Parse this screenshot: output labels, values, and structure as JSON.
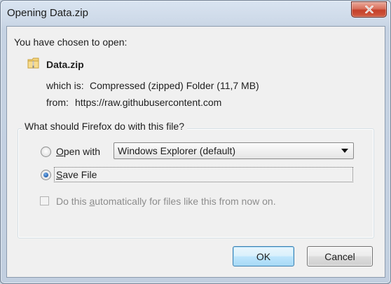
{
  "window": {
    "title": "Opening Data.zip"
  },
  "content": {
    "intro": "You have chosen to open:",
    "filename": "Data.zip",
    "which_is_label": "which is:",
    "which_is_value": "Compressed (zipped) Folder (11,7 MB)",
    "from_label": "from:",
    "from_value": "https://raw.githubusercontent.com"
  },
  "group": {
    "caption": "What should Firefox do with this file?",
    "open_with_label_key": "O",
    "open_with_label_rest": "pen with",
    "open_with_selected": "Windows Explorer (default)",
    "save_file_label_key": "S",
    "save_file_label_rest": "ave File",
    "save_file_selected": true,
    "auto_label_pre": "Do this ",
    "auto_label_key": "a",
    "auto_label_post": "utomatically for files like this from now on.",
    "auto_checked": false
  },
  "buttons": {
    "ok": "OK",
    "cancel": "Cancel"
  },
  "icons": {
    "file": "zip-folder-icon",
    "close": "close-icon",
    "dropdown": "chevron-down-icon"
  }
}
